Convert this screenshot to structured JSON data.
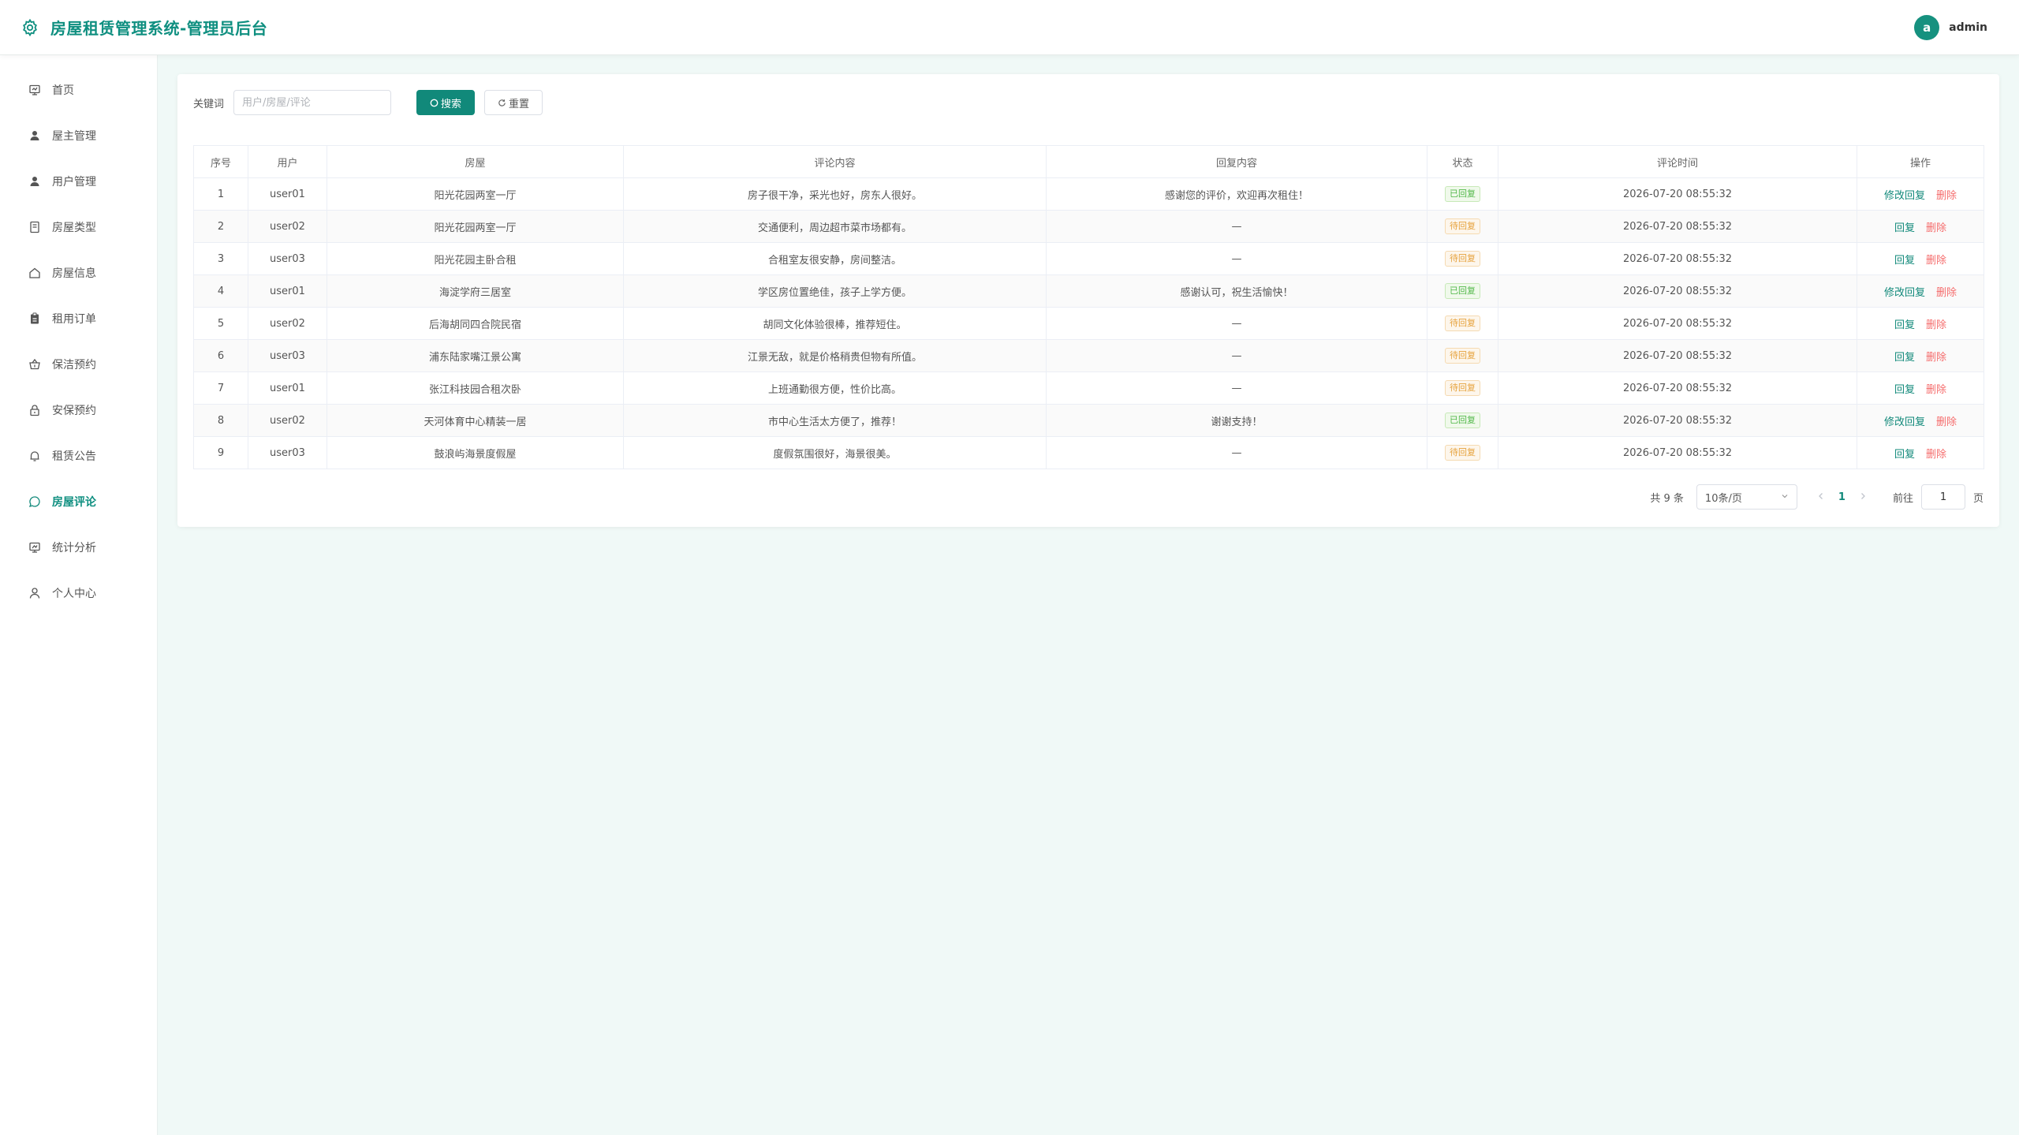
{
  "header": {
    "title": "房屋租赁管理系统-管理员后台",
    "avatar_letter": "a",
    "username": "admin"
  },
  "sidebar": {
    "items": [
      {
        "label": "首页",
        "icon": "dashboard-icon"
      },
      {
        "label": "屋主管理",
        "icon": "user-solid-icon"
      },
      {
        "label": "用户管理",
        "icon": "user-solid-icon"
      },
      {
        "label": "房屋类型",
        "icon": "document-icon"
      },
      {
        "label": "房屋信息",
        "icon": "house-icon"
      },
      {
        "label": "租用订单",
        "icon": "clipboard-icon"
      },
      {
        "label": "保洁预约",
        "icon": "basket-icon"
      },
      {
        "label": "安保预约",
        "icon": "lock-icon"
      },
      {
        "label": "租赁公告",
        "icon": "bell-icon"
      },
      {
        "label": "房屋评论",
        "icon": "chat-icon"
      },
      {
        "label": "统计分析",
        "icon": "chart-icon"
      },
      {
        "label": "个人中心",
        "icon": "user-icon"
      }
    ],
    "active_index": 9
  },
  "search": {
    "label": "关键词",
    "placeholder": "用户/房屋/评论",
    "value": "",
    "search_button": "搜索",
    "reset_button": "重置"
  },
  "table": {
    "columns": [
      "序号",
      "用户",
      "房屋",
      "评论内容",
      "回复内容",
      "状态",
      "评论时间",
      "操作"
    ],
    "rows": [
      {
        "no": "1",
        "user": "user01",
        "house": "阳光花园两室一厅",
        "comment": "房子很干净，采光也好，房东人很好。",
        "reply": "感谢您的评价，欢迎再次租住！",
        "status": "已回复",
        "status_type": "ok",
        "time": "2026-07-20 08:55:32",
        "op_reply": "修改回复",
        "op_delete": "删除"
      },
      {
        "no": "2",
        "user": "user02",
        "house": "阳光花园两室一厅",
        "comment": "交通便利，周边超市菜市场都有。",
        "reply": "—",
        "status": "待回复",
        "status_type": "wait",
        "time": "2026-07-20 08:55:32",
        "op_reply": "回复",
        "op_delete": "删除"
      },
      {
        "no": "3",
        "user": "user03",
        "house": "阳光花园主卧合租",
        "comment": "合租室友很安静，房间整洁。",
        "reply": "—",
        "status": "待回复",
        "status_type": "wait",
        "time": "2026-07-20 08:55:32",
        "op_reply": "回复",
        "op_delete": "删除"
      },
      {
        "no": "4",
        "user": "user01",
        "house": "海淀学府三居室",
        "comment": "学区房位置绝佳，孩子上学方便。",
        "reply": "感谢认可，祝生活愉快！",
        "status": "已回复",
        "status_type": "ok",
        "time": "2026-07-20 08:55:32",
        "op_reply": "修改回复",
        "op_delete": "删除"
      },
      {
        "no": "5",
        "user": "user02",
        "house": "后海胡同四合院民宿",
        "comment": "胡同文化体验很棒，推荐短住。",
        "reply": "—",
        "status": "待回复",
        "status_type": "wait",
        "time": "2026-07-20 08:55:32",
        "op_reply": "回复",
        "op_delete": "删除"
      },
      {
        "no": "6",
        "user": "user03",
        "house": "浦东陆家嘴江景公寓",
        "comment": "江景无敌，就是价格稍贵但物有所值。",
        "reply": "—",
        "status": "待回复",
        "status_type": "wait",
        "time": "2026-07-20 08:55:32",
        "op_reply": "回复",
        "op_delete": "删除"
      },
      {
        "no": "7",
        "user": "user01",
        "house": "张江科技园合租次卧",
        "comment": "上班通勤很方便，性价比高。",
        "reply": "—",
        "status": "待回复",
        "status_type": "wait",
        "time": "2026-07-20 08:55:32",
        "op_reply": "回复",
        "op_delete": "删除"
      },
      {
        "no": "8",
        "user": "user02",
        "house": "天河体育中心精装一居",
        "comment": "市中心生活太方便了，推荐！",
        "reply": "谢谢支持！",
        "status": "已回复",
        "status_type": "ok",
        "time": "2026-07-20 08:55:32",
        "op_reply": "修改回复",
        "op_delete": "删除"
      },
      {
        "no": "9",
        "user": "user03",
        "house": "鼓浪屿海景度假屋",
        "comment": "度假氛围很好，海景很美。",
        "reply": "—",
        "status": "待回复",
        "status_type": "wait",
        "time": "2026-07-20 08:55:32",
        "op_reply": "回复",
        "op_delete": "删除"
      }
    ]
  },
  "pagination": {
    "total_text": "共 9 条",
    "page_size": "10条/页",
    "current_page": "1",
    "goto_label": "前往",
    "goto_value": "1",
    "page_suffix": "页"
  },
  "colors": {
    "primary": "#11897a",
    "danger": "#f56c6c",
    "success": "#52b84a",
    "warning": "#e6a23c",
    "background": "#f0f9f7"
  }
}
